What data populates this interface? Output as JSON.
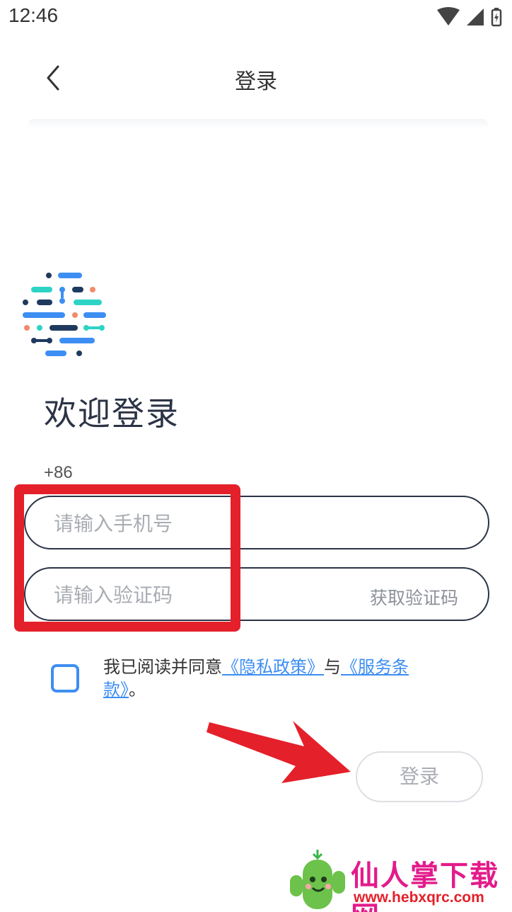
{
  "status_bar": {
    "time": "12:46"
  },
  "nav": {
    "title": "登录"
  },
  "welcome": "欢迎登录",
  "country_code": "+86",
  "phone_input": {
    "placeholder": "请输入手机号",
    "value": ""
  },
  "code_input": {
    "placeholder": "请输入验证码",
    "value": ""
  },
  "get_code_label": "获取验证码",
  "agreement": {
    "prefix": "我已阅读并同意",
    "privacy_link": "《隐私政策》",
    "conjunction": "与",
    "terms_link": "《服务条款》",
    "suffix": "。",
    "checked": false
  },
  "login_button": "登录",
  "watermark": {
    "text": "仙人掌下载网",
    "url": "www.hebxqrc.com"
  },
  "colors": {
    "accent": "#3d8ef3",
    "annotation_red": "#e4202a",
    "text_dark": "#2b3445"
  }
}
